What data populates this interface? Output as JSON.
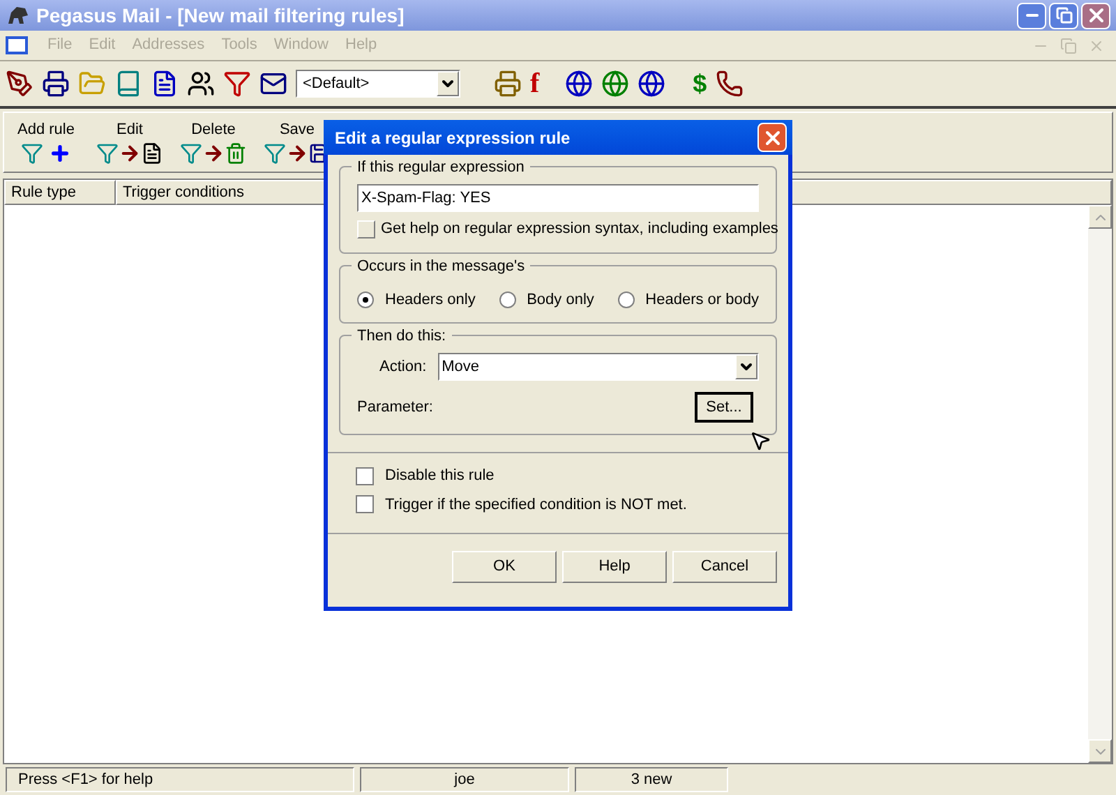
{
  "window": {
    "title": "Pegasus Mail - [New mail filtering rules]"
  },
  "menu": [
    {
      "label": "File",
      "disabled": true
    },
    {
      "label": "Edit",
      "disabled": true
    },
    {
      "label": "Addresses",
      "disabled": true
    },
    {
      "label": "Tools",
      "disabled": true
    },
    {
      "label": "Window",
      "disabled": true
    },
    {
      "label": "Help",
      "disabled": true
    }
  ],
  "toolbar": {
    "identity": "<Default>",
    "glyphs": [
      "f",
      "$"
    ]
  },
  "rule_toolbar": [
    {
      "label": "Add rule",
      "kind": "add"
    },
    {
      "label": "Edit",
      "kind": "edit"
    },
    {
      "label": "Delete",
      "kind": "delete"
    },
    {
      "label": "Save",
      "kind": "save"
    }
  ],
  "list": {
    "columns": [
      "Rule type",
      "Trigger conditions"
    ]
  },
  "dialog": {
    "title": "Edit a regular expression rule",
    "expression_group": {
      "label": "If this regular expression",
      "value": "X-Spam-Flag: YES",
      "help_button": "Get help on regular expression syntax, including examples"
    },
    "occurs_group": {
      "label": "Occurs in the message's",
      "options": [
        {
          "label": "Headers only",
          "selected": true
        },
        {
          "label": "Body only",
          "selected": false
        },
        {
          "label": "Headers or body",
          "selected": false
        }
      ]
    },
    "action_group": {
      "label": "Then do this:",
      "action_label": "Action:",
      "action_value": "Move",
      "parameter_label": "Parameter:",
      "set_button": "Set..."
    },
    "checkboxes": [
      {
        "label": "Disable this rule",
        "checked": false
      },
      {
        "label": "Trigger if the specified condition is NOT met.",
        "checked": false
      }
    ],
    "buttons": [
      "OK",
      "Help",
      "Cancel"
    ]
  },
  "status_bar": [
    "Press <F1> for help",
    "joe",
    "3 new"
  ]
}
